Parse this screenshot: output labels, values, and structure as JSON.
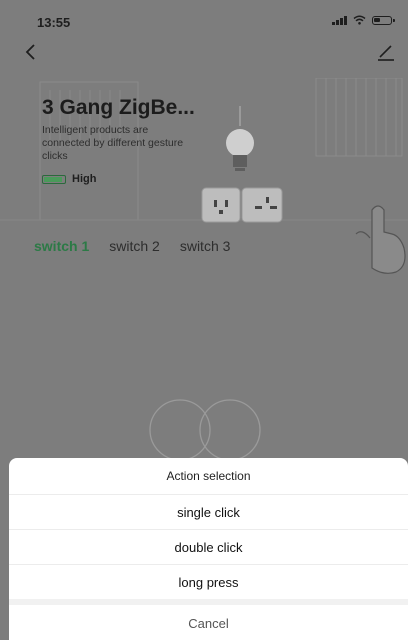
{
  "status_bar": {
    "time": "13:55"
  },
  "device": {
    "name": "3 Gang ZigBe...",
    "description": "Intelligent products are connected by different gesture clicks",
    "battery_level": "High"
  },
  "tabs": [
    {
      "label": "switch 1",
      "active": true
    },
    {
      "label": "switch 2",
      "active": false
    },
    {
      "label": "switch 3",
      "active": false
    }
  ],
  "action_sheet": {
    "title": "Action selection",
    "options": [
      "single click",
      "double click",
      "long press"
    ],
    "cancel_label": "Cancel"
  },
  "colors": {
    "accent_green": "#2c7a46",
    "overlay": "#7d7d7d",
    "sheet_bg": "#ffffff"
  }
}
